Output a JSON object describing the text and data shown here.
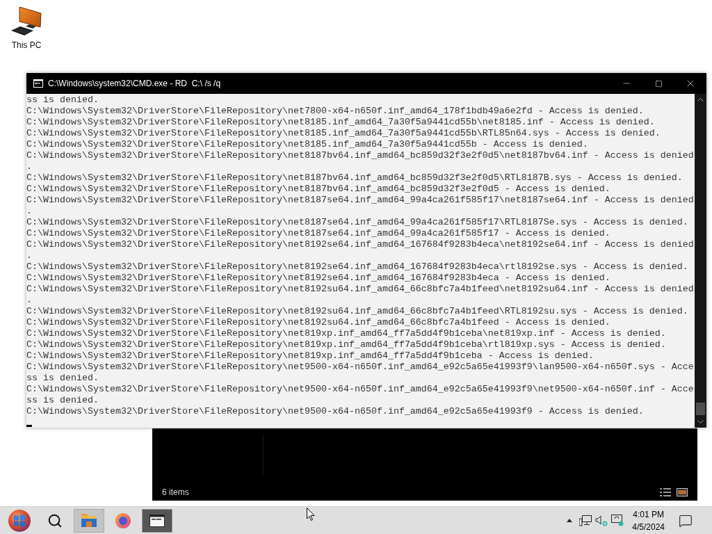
{
  "desktop": {
    "icons": [
      {
        "label": "This PC"
      }
    ]
  },
  "console_window": {
    "title": "C:\\Windows\\system32\\CMD.exe - RD  C:\\ /s /q",
    "lines": [
      "ss is denied.",
      "C:\\Windows\\System32\\DriverStore\\FileRepository\\net7800-x64-n650f.inf_amd64_178f1bdb49a6e2fd - Access is denied.",
      "C:\\Windows\\System32\\DriverStore\\FileRepository\\net8185.inf_amd64_7a30f5a9441cd55b\\net8185.inf - Access is denied.",
      "C:\\Windows\\System32\\DriverStore\\FileRepository\\net8185.inf_amd64_7a30f5a9441cd55b\\RTL85n64.sys - Access is denied.",
      "C:\\Windows\\System32\\DriverStore\\FileRepository\\net8185.inf_amd64_7a30f5a9441cd55b - Access is denied.",
      "C:\\Windows\\System32\\DriverStore\\FileRepository\\net8187bv64.inf_amd64_bc859d32f3e2f0d5\\net8187bv64.inf - Access is denied",
      ".",
      "C:\\Windows\\System32\\DriverStore\\FileRepository\\net8187bv64.inf_amd64_bc859d32f3e2f0d5\\RTL8187B.sys - Access is denied.",
      "C:\\Windows\\System32\\DriverStore\\FileRepository\\net8187bv64.inf_amd64_bc859d32f3e2f0d5 - Access is denied.",
      "C:\\Windows\\System32\\DriverStore\\FileRepository\\net8187se64.inf_amd64_99a4ca261f585f17\\net8187se64.inf - Access is denied",
      ".",
      "C:\\Windows\\System32\\DriverStore\\FileRepository\\net8187se64.inf_amd64_99a4ca261f585f17\\RTL8187Se.sys - Access is denied.",
      "C:\\Windows\\System32\\DriverStore\\FileRepository\\net8187se64.inf_amd64_99a4ca261f585f17 - Access is denied.",
      "C:\\Windows\\System32\\DriverStore\\FileRepository\\net8192se64.inf_amd64_167684f9283b4eca\\net8192se64.inf - Access is denied",
      ".",
      "C:\\Windows\\System32\\DriverStore\\FileRepository\\net8192se64.inf_amd64_167684f9283b4eca\\rtl8192se.sys - Access is denied.",
      "C:\\Windows\\System32\\DriverStore\\FileRepository\\net8192se64.inf_amd64_167684f9283b4eca - Access is denied.",
      "C:\\Windows\\System32\\DriverStore\\FileRepository\\net8192su64.inf_amd64_66c8bfc7a4b1feed\\net8192su64.inf - Access is denied",
      ".",
      "C:\\Windows\\System32\\DriverStore\\FileRepository\\net8192su64.inf_amd64_66c8bfc7a4b1feed\\RTL8192su.sys - Access is denied.",
      "C:\\Windows\\System32\\DriverStore\\FileRepository\\net8192su64.inf_amd64_66c8bfc7a4b1feed - Access is denied.",
      "C:\\Windows\\System32\\DriverStore\\FileRepository\\net819xp.inf_amd64_ff7a5dd4f9b1ceba\\net819xp.inf - Access is denied.",
      "C:\\Windows\\System32\\DriverStore\\FileRepository\\net819xp.inf_amd64_ff7a5dd4f9b1ceba\\rtl819xp.sys - Access is denied.",
      "C:\\Windows\\System32\\DriverStore\\FileRepository\\net819xp.inf_amd64_ff7a5dd4f9b1ceba - Access is denied.",
      "C:\\Windows\\System32\\DriverStore\\FileRepository\\net9500-x64-n650f.inf_amd64_e92c5a65e41993f9\\lan9500-x64-n650f.sys - Acce",
      "ss is denied.",
      "C:\\Windows\\System32\\DriverStore\\FileRepository\\net9500-x64-n650f.inf_amd64_e92c5a65e41993f9\\net9500-x64-n650f.inf - Acce",
      "ss is denied.",
      "C:\\Windows\\System32\\DriverStore\\FileRepository\\net9500-x64-n650f.inf_amd64_e92c5a65e41993f9 - Access is denied."
    ]
  },
  "explorer_window": {
    "status": "6 items"
  },
  "taskbar": {
    "apps": [
      {
        "kind": "folder",
        "open": true,
        "selected": false
      },
      {
        "kind": "browser",
        "open": false,
        "selected": false
      },
      {
        "kind": "terminal",
        "open": true,
        "selected": true
      }
    ],
    "clock": {
      "time": "4:01 PM",
      "date": "4/5/2024"
    }
  }
}
